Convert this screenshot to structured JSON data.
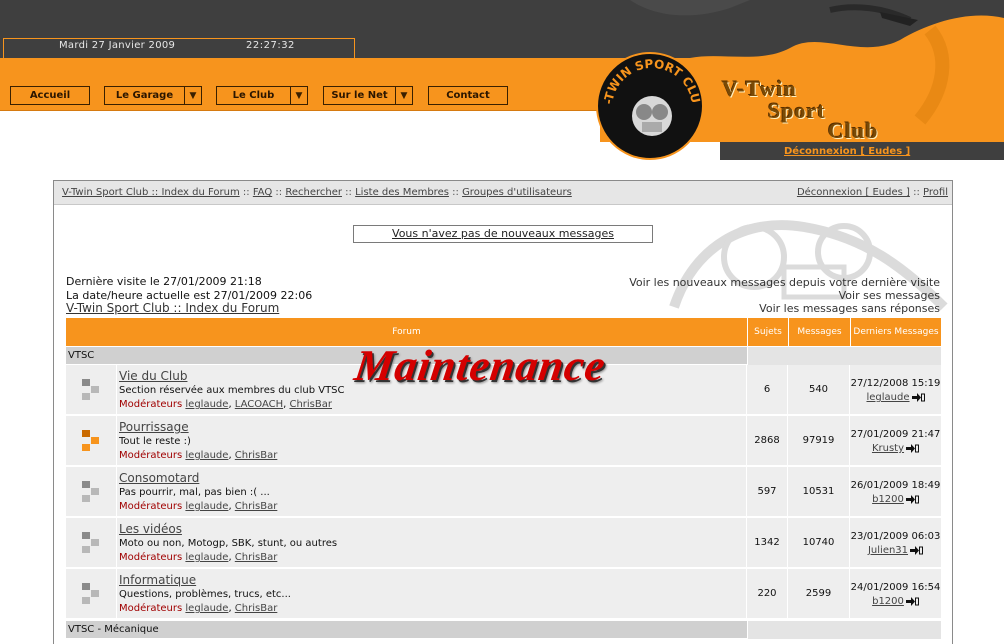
{
  "header": {
    "date": "Mardi 27 Janvier 2009",
    "time": "22:27:32",
    "nav": [
      {
        "label": "Accueil",
        "has_dropdown": false
      },
      {
        "label": "Le Garage",
        "has_dropdown": true
      },
      {
        "label": "Le Club",
        "has_dropdown": true
      },
      {
        "label": "Sur le Net",
        "has_dropdown": true
      },
      {
        "label": "Contact",
        "has_dropdown": false
      }
    ],
    "logo_text": "V-TWIN SPORT CLUB",
    "brand": [
      "V-Twin",
      "Sport",
      "Club"
    ],
    "logout": "Déconnexion [ Eudes ]",
    "colors": {
      "accent": "#f7941d",
      "dark": "#3f3f3f"
    }
  },
  "topnav": {
    "left": [
      {
        "label": "V-Twin Sport Club :: Index du Forum"
      },
      {
        "label": "FAQ"
      },
      {
        "label": "Rechercher"
      },
      {
        "label": "Liste des Membres"
      },
      {
        "label": "Groupes d'utilisateurs"
      }
    ],
    "separator": "::",
    "right": [
      {
        "label": "Déconnexion [ Eudes ]"
      },
      {
        "label": "Profil"
      }
    ]
  },
  "info": {
    "no_new_messages": "Vous n'avez pas de nouveaux messages",
    "last_visit": "Dernière visite le 27/01/2009 21:18",
    "current_date": "La date/heure actuelle est 27/01/2009 22:06",
    "index_link": "V-Twin Sport Club :: Index du Forum",
    "right_links": [
      "Voir les nouveaux messages depuis votre dernière visite",
      "Voir ses messages",
      "Voir les messages sans réponses"
    ]
  },
  "table": {
    "headers": {
      "forum": "Forum",
      "topics": "Sujets",
      "messages": "Messages",
      "last": "Derniers Messages"
    },
    "categories": [
      "VTSC",
      "VTSC - Mécanique"
    ],
    "moderators_label": "Modérateurs",
    "forums": [
      {
        "title": "Vie du Club",
        "desc": "Section réservée aux membres du club VTSC",
        "mods": [
          "leglaude",
          "LACOACH",
          "ChrisBar"
        ],
        "topics": "6",
        "messages": "540",
        "last_date": "27/12/2008 15:19",
        "last_user": "leglaude",
        "has_new": false
      },
      {
        "title": "Pourrissage",
        "desc": "Tout le reste :)",
        "mods": [
          "leglaude",
          "ChrisBar"
        ],
        "topics": "2868",
        "messages": "97919",
        "last_date": "27/01/2009 21:47",
        "last_user": "Krusty",
        "has_new": true
      },
      {
        "title": "Consomotard",
        "desc": "Pas pourrir, mal, pas bien :( ...",
        "mods": [
          "leglaude",
          "ChrisBar"
        ],
        "topics": "597",
        "messages": "10531",
        "last_date": "26/01/2009 18:49",
        "last_user": "b1200",
        "has_new": false
      },
      {
        "title": "Les vidéos",
        "desc": "Moto ou non, Motogp, SBK, stunt, ou autres",
        "mods": [
          "leglaude",
          "ChrisBar"
        ],
        "topics": "1342",
        "messages": "10740",
        "last_date": "23/01/2009 06:03",
        "last_user": "Julien31",
        "has_new": false
      },
      {
        "title": "Informatique",
        "desc": "Questions, problèmes, trucs, etc...",
        "mods": [
          "leglaude",
          "ChrisBar"
        ],
        "topics": "220",
        "messages": "2599",
        "last_date": "24/01/2009 16:54",
        "last_user": "b1200",
        "has_new": false
      }
    ]
  },
  "overlay": {
    "text": "Maintenance",
    "color": "#d40000"
  }
}
